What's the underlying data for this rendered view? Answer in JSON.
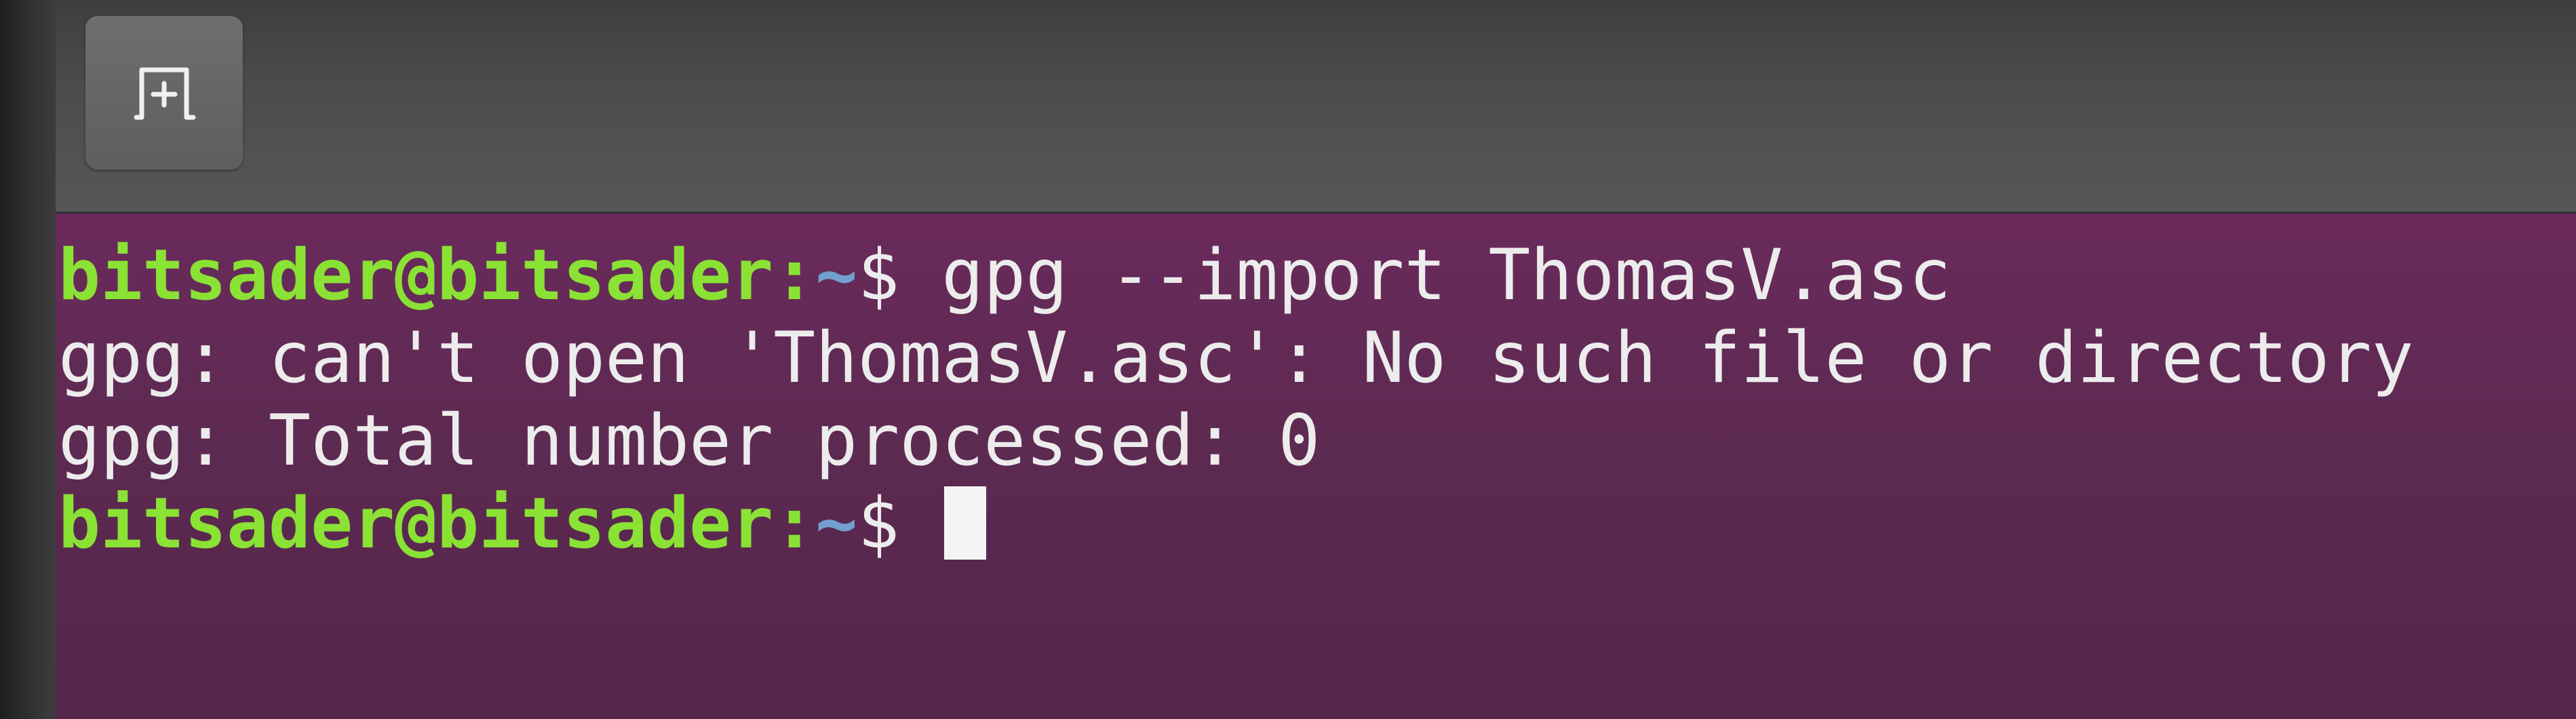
{
  "titlebar": {
    "new_tab_icon": "new-terminal-tab-icon"
  },
  "terminal": {
    "prompt": {
      "user_host": "bitsader@bitsader",
      "colon": ":",
      "path": "~",
      "symbol": "$"
    },
    "lines": [
      {
        "type": "command",
        "command": "gpg --import ThomasV.asc"
      },
      {
        "type": "output",
        "text": "gpg: can't open 'ThomasV.asc': No such file or directory"
      },
      {
        "type": "output",
        "text": "gpg: Total number processed: 0"
      },
      {
        "type": "prompt",
        "command": ""
      }
    ]
  },
  "colors": {
    "terminal_background": "#5e2a52",
    "prompt_user": "#8ae234",
    "prompt_path": "#729fcf",
    "text": "#ececec",
    "titlebar": "#4a4a4a"
  }
}
